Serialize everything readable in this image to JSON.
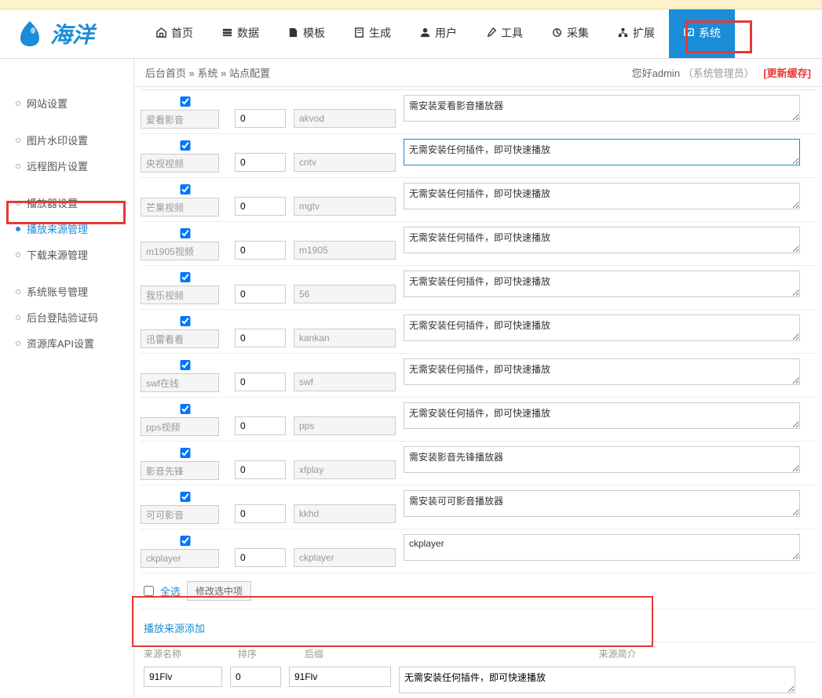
{
  "logo": {
    "text": "海洋"
  },
  "nav": [
    {
      "label": "首页",
      "icon": "home"
    },
    {
      "label": "数据",
      "icon": "data"
    },
    {
      "label": "模板",
      "icon": "template"
    },
    {
      "label": "生成",
      "icon": "generate"
    },
    {
      "label": "用户",
      "icon": "user"
    },
    {
      "label": "工具",
      "icon": "tool"
    },
    {
      "label": "采集",
      "icon": "collect"
    },
    {
      "label": "扩展",
      "icon": "extend"
    },
    {
      "label": "系统",
      "icon": "system",
      "active": true
    }
  ],
  "breadcrumb": {
    "parts": [
      "后台首页",
      "系统",
      "站点配置"
    ],
    "sep": " » "
  },
  "userbar": {
    "greeting": "您好",
    "username": "admin",
    "role": "（系统管理员）",
    "update_cache": "[更新缓存]"
  },
  "sidebar": {
    "groups": [
      [
        "网站设置"
      ],
      [
        "图片水印设置",
        "远程图片设置"
      ],
      [
        "播放器设置",
        "播放来源管理",
        "下载来源管理"
      ],
      [
        "系统账号管理",
        "后台登陆验证码",
        "资源库API设置"
      ]
    ],
    "active": "播放来源管理"
  },
  "rows": [
    {
      "checked": true,
      "name": "爱看影音",
      "order": "0",
      "suffix": "akvod",
      "desc": "需安装爱看影音播放器"
    },
    {
      "checked": true,
      "name": "央视视频",
      "order": "0",
      "suffix": "cntv",
      "desc": "无需安装任何插件，即可快速播放",
      "highlighted": true
    },
    {
      "checked": true,
      "name": "芒果视频",
      "order": "0",
      "suffix": "mgtv",
      "desc": "无需安装任何插件，即可快速播放"
    },
    {
      "checked": true,
      "name": "m1905视频",
      "order": "0",
      "suffix": "m1905",
      "desc": "无需安装任何插件，即可快速播放"
    },
    {
      "checked": true,
      "name": "我乐视频",
      "order": "0",
      "suffix": "56",
      "desc": "无需安装任何插件，即可快速播放"
    },
    {
      "checked": true,
      "name": "迅雷看看",
      "order": "0",
      "suffix": "kankan",
      "desc": "无需安装任何插件，即可快速播放"
    },
    {
      "checked": true,
      "name": "swf在线",
      "order": "0",
      "suffix": "swf",
      "desc": "无需安装任何插件，即可快速播放"
    },
    {
      "checked": true,
      "name": "pps视频",
      "order": "0",
      "suffix": "pps",
      "desc": "无需安装任何插件，即可快速播放"
    },
    {
      "checked": true,
      "name": "影音先锋",
      "order": "0",
      "suffix": "xfplay",
      "desc": "需安装影音先锋播放器"
    },
    {
      "checked": true,
      "name": "可可影音",
      "order": "0",
      "suffix": "kkhd",
      "desc": "需安装可可影音播放器"
    },
    {
      "checked": true,
      "name": "ckplayer",
      "order": "0",
      "suffix": "ckplayer",
      "desc": "ckplayer"
    }
  ],
  "select_all": {
    "link": "全选",
    "button": "修改选中项"
  },
  "add_section": {
    "title": "播放来源添加",
    "headers": {
      "name": "来源名称",
      "order": "排序",
      "suffix": "后缀",
      "desc": "来源简介"
    },
    "values": {
      "name": "91Flv",
      "order": "0",
      "suffix": "91Flv",
      "desc": "无需安装任何插件，即可快速播放"
    }
  }
}
